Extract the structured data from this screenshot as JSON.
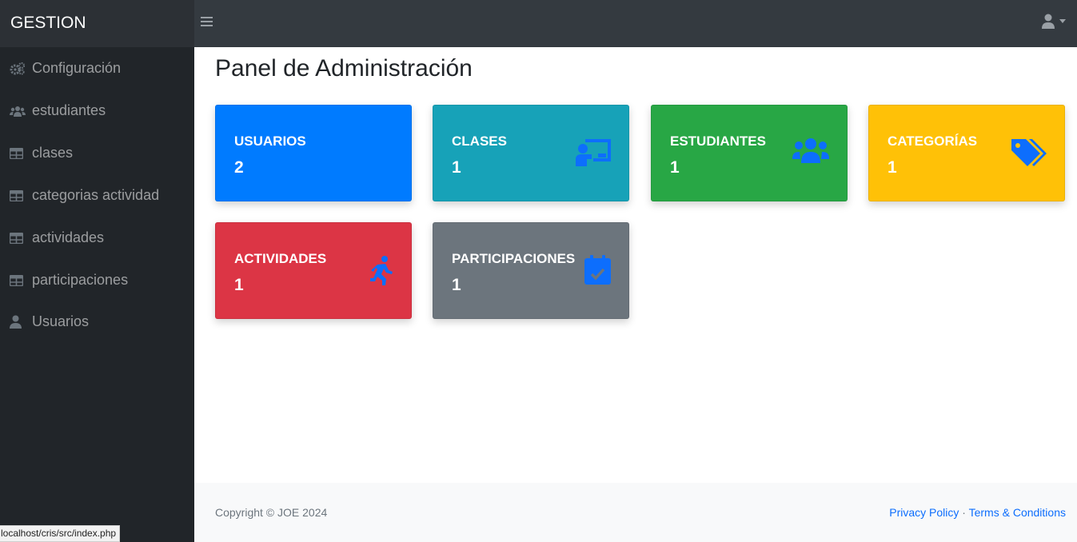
{
  "brand": "GESTION",
  "sidebar": {
    "items": [
      {
        "label": "Configuración",
        "icon": "cogs-icon"
      },
      {
        "label": "estudiantes",
        "icon": "users-icon"
      },
      {
        "label": "clases",
        "icon": "table-icon"
      },
      {
        "label": "categorias actividad",
        "icon": "table-icon"
      },
      {
        "label": "actividades",
        "icon": "table-icon"
      },
      {
        "label": "participaciones",
        "icon": "table-icon"
      },
      {
        "label": "Usuarios",
        "icon": "user-icon"
      }
    ]
  },
  "page_title": "Panel de Administración",
  "cards": [
    {
      "label": "USUARIOS",
      "count": "2",
      "color": "#007bff",
      "icon": ""
    },
    {
      "label": "CLASES",
      "count": "1",
      "color": "#17a2b8",
      "icon": "chalkboard-teacher-icon"
    },
    {
      "label": "ESTUDIANTES",
      "count": "1",
      "color": "#28a745",
      "icon": "users-icon"
    },
    {
      "label": "CATEGORÍAS",
      "count": "1",
      "color": "#ffc107",
      "icon": "tags-icon"
    },
    {
      "label": "ACTIVIDADES",
      "count": "1",
      "color": "#dc3545",
      "icon": "running-icon"
    },
    {
      "label": "PARTICIPACIONES",
      "count": "1",
      "color": "#6c757d",
      "icon": "calendar-check-icon"
    }
  ],
  "card_icon_color": "#0d6efd",
  "footer": {
    "copyright": "Copyright © JOE 2024",
    "privacy": "Privacy Policy",
    "separator": "·",
    "terms": "Terms & Conditions"
  },
  "status_url": "localhost/cris/src/index.php"
}
